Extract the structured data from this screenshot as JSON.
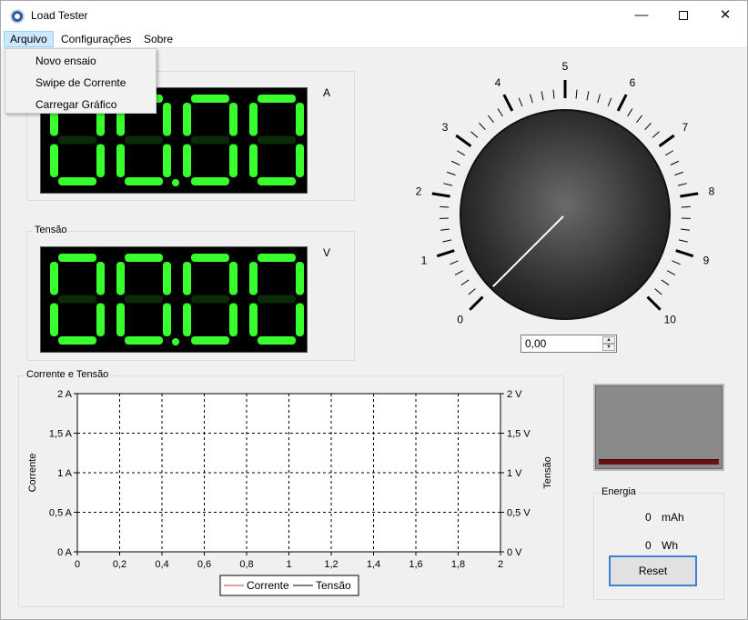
{
  "window": {
    "title": "Load Tester",
    "minimize": "—",
    "maximize": "",
    "close": "✕"
  },
  "menu": {
    "items": [
      "Arquivo",
      "Configurações",
      "Sobre"
    ]
  },
  "dropdown": {
    "items": [
      "Novo ensaio",
      "Swipe de Corrente",
      "Carregar Gráfico"
    ]
  },
  "current_group": {
    "label": "",
    "unit": "A",
    "display_value": "00.00"
  },
  "voltage_group": {
    "label": "Tensão",
    "unit": "V",
    "display_value": "00.00"
  },
  "knob": {
    "scale_labels": [
      "0",
      "1",
      "2",
      "3",
      "4",
      "5",
      "6",
      "7",
      "8",
      "9",
      "10"
    ],
    "value": 0,
    "spin_value": "0,00"
  },
  "chart_group": {
    "label": "Corrente e Tensão"
  },
  "chart_data": {
    "type": "line",
    "x": [],
    "series": [
      {
        "name": "Corrente",
        "color": "#c84040",
        "values": []
      },
      {
        "name": "Tensão",
        "color": "#000000",
        "values": []
      }
    ],
    "xlim": [
      0,
      2
    ],
    "ylim_left": [
      0,
      2
    ],
    "ylim_right": [
      0,
      2
    ],
    "x_ticks": [
      "0",
      "0,2",
      "0,4",
      "0,6",
      "0,8",
      "1",
      "1,2",
      "1,4",
      "1,6",
      "1,8",
      "2"
    ],
    "y_left_ticks": [
      "0 A",
      "0,5 A",
      "1 A",
      "1,5 A",
      "2 A"
    ],
    "y_right_ticks": [
      "0 V",
      "0,5 V",
      "1 V",
      "1,5 V",
      "2 V"
    ],
    "ylabel_left": "Corrente",
    "ylabel_right": "Tensão",
    "grid": true,
    "legend_position": "bottom-center"
  },
  "energy_group": {
    "label": "Energia",
    "mah_value": "0",
    "mah_unit": "mAh",
    "wh_value": "0",
    "wh_unit": "Wh",
    "reset_label": "Reset"
  },
  "colors": {
    "segment_on": "#39ff2e",
    "segment_off": "#0a2a08",
    "display_bg": "#000000"
  }
}
